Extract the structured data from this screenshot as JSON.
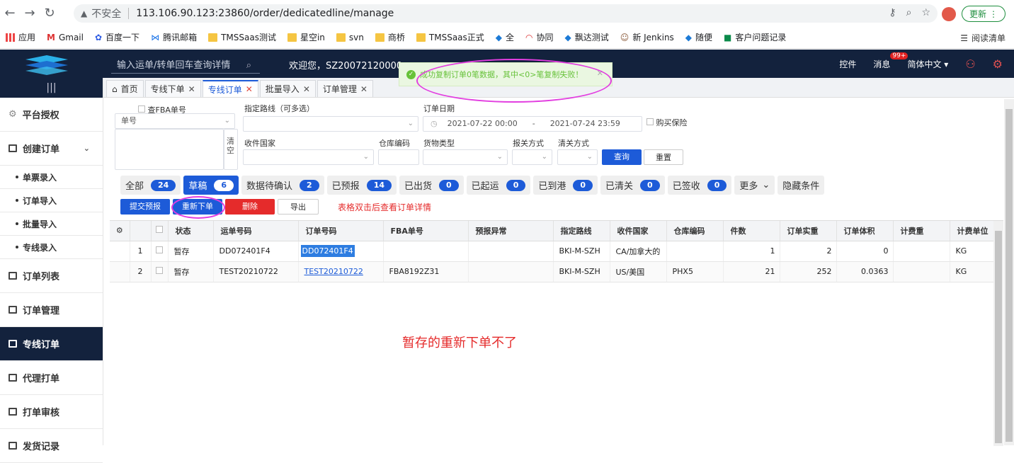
{
  "browser": {
    "insecure_label": "不安全",
    "url": "113.106.90.123:23860/order/dedicatedline/manage",
    "update_label": "更新",
    "bookmarks": [
      "应用",
      "Gmail",
      "百度一下",
      "腾讯邮箱",
      "TMSSaas测试",
      "星空in",
      "svn",
      "商桥",
      "TMSSaas正式",
      "全",
      "协同",
      "飘达测试",
      "新 Jenkins",
      "随便",
      "客户问题记录"
    ],
    "reading_list": "阅读清单"
  },
  "header": {
    "search_placeholder": "输入运单/转单回车查询详情",
    "welcome": "欢迎您，SZ20072120000",
    "controls": "控件",
    "messages": "消息",
    "message_badge": "99+",
    "language": "简体中文"
  },
  "toast": {
    "message": "成功复制订单0笔数据，其中<0>笔复制失败！"
  },
  "sidebar": {
    "items": [
      {
        "label": "平台授权"
      },
      {
        "label": "创建订单"
      },
      {
        "label": "单票录入"
      },
      {
        "label": "订单导入"
      },
      {
        "label": "批量导入"
      },
      {
        "label": "专线录入"
      },
      {
        "label": "订单列表"
      },
      {
        "label": "订单管理"
      },
      {
        "label": "专线订单"
      },
      {
        "label": "代理打单"
      },
      {
        "label": "打单审核"
      },
      {
        "label": "发货记录"
      }
    ]
  },
  "tabs": [
    {
      "label": "首页"
    },
    {
      "label": "专线下单"
    },
    {
      "label": "专线订单"
    },
    {
      "label": "批量导入"
    },
    {
      "label": "订单管理"
    }
  ],
  "filters": {
    "fba_check": "查FBA单号",
    "order_no_select": "单号",
    "clear": "清空",
    "route_label": "指定路线（可多选）",
    "date_label": "订单日期",
    "date_start": "2021-07-22 00:00",
    "date_sep": "-",
    "date_end": "2021-07-24 23:59",
    "insurance": "购买保险",
    "country_label": "收件国家",
    "warehouse_label": "仓库编码",
    "goods_label": "货物类型",
    "customs_label": "报关方式",
    "clearance_label": "清关方式",
    "query_btn": "查询",
    "reset_btn": "重置"
  },
  "statuses": [
    {
      "label": "全部",
      "count": "24"
    },
    {
      "label": "草稿",
      "count": "6"
    },
    {
      "label": "数据待确认",
      "count": "2"
    },
    {
      "label": "已预报",
      "count": "14"
    },
    {
      "label": "已出货",
      "count": "0"
    },
    {
      "label": "已起运",
      "count": "0"
    },
    {
      "label": "已到港",
      "count": "0"
    },
    {
      "label": "已清关",
      "count": "0"
    },
    {
      "label": "已签收",
      "count": "0"
    }
  ],
  "more_label": "更多",
  "hide_label": "隐藏条件",
  "actions": {
    "submit": "提交预报",
    "reorder": "重新下单",
    "delete": "删除",
    "export": "导出",
    "hint": "表格双击后查看订单详情"
  },
  "table": {
    "columns": [
      "状态",
      "运单号码",
      "订单号码",
      "FBA单号",
      "预报异常",
      "指定路线",
      "收件国家",
      "仓库编码",
      "件数",
      "订单实重",
      "订单体积",
      "计费重",
      "计费单位"
    ],
    "rows": [
      {
        "idx": "1",
        "status": "暂存",
        "waybill": "DD072401F4",
        "order": "DD072401F4",
        "fba": "",
        "abnormal": "",
        "route": "BKI-M-SZH",
        "country": "CA/加拿大的",
        "warehouse": "",
        "pieces": "1",
        "weight": "2",
        "volume": "0",
        "charge_weight": "",
        "unit": "KG"
      },
      {
        "idx": "2",
        "status": "暂存",
        "waybill": "TEST20210722",
        "order": "TEST20210722",
        "fba": "FBA8192Z31",
        "abnormal": "",
        "route": "BKI-M-SZH",
        "country": "US/美国",
        "warehouse": "PHX5",
        "pieces": "21",
        "weight": "252",
        "volume": "0.0363",
        "charge_weight": "",
        "unit": "KG"
      }
    ]
  },
  "annotation": "暂存的重新下单不了"
}
